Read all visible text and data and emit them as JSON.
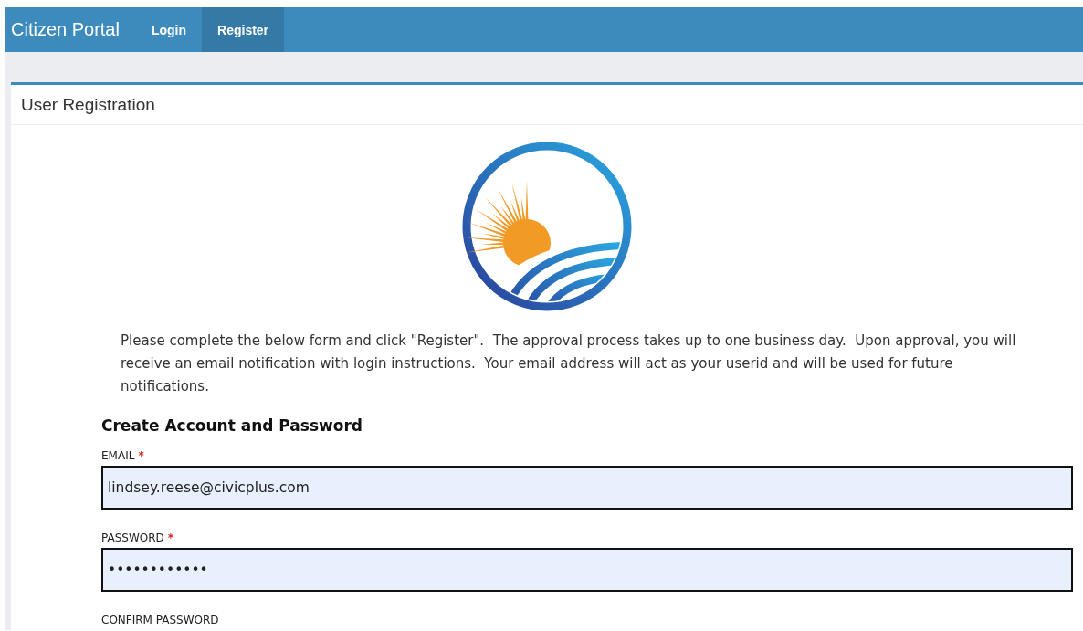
{
  "navbar": {
    "brand": "Citizen Portal",
    "links": [
      {
        "label": "Login",
        "selected": false
      },
      {
        "label": "Register",
        "selected": true
      }
    ]
  },
  "panel": {
    "title": "User Registration",
    "intro": "Please complete the below form and click \"Register\".  The approval process takes up to one business day.  Upon approval, you will receive an email notification with login instructions.  Your email address will act as your userid and will be used for future notifications.",
    "section_title": "Create Account and Password",
    "fields": [
      {
        "label": "EMAIL",
        "required_mark": "*",
        "value": "lindsey.reese@civicplus.com"
      },
      {
        "label": "PASSWORD",
        "required_mark": "*",
        "value": "••••••••••••"
      },
      {
        "label": "CONFIRM PASSWORD"
      }
    ]
  }
}
